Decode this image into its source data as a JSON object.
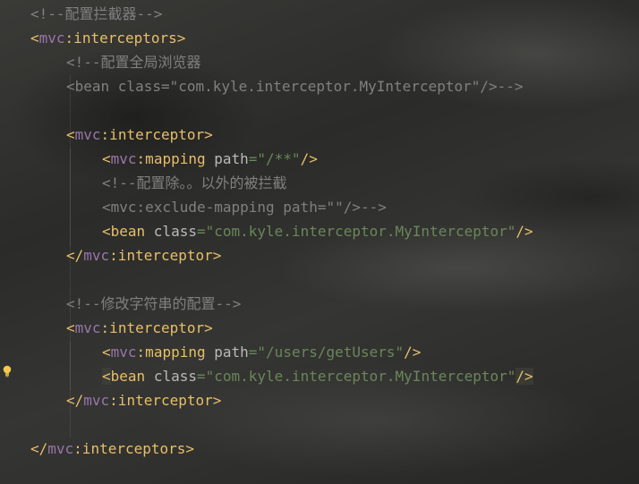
{
  "code": {
    "lines": [
      {
        "segments": [
          {
            "cls": "c",
            "text": "<!--配置拦截器-->"
          }
        ]
      },
      {
        "segments": [
          {
            "cls": "t",
            "text": "<"
          },
          {
            "cls": "ns",
            "text": "mvc"
          },
          {
            "cls": "t",
            "text": ":interceptors>"
          }
        ]
      },
      {
        "segments": [
          {
            "cls": "c",
            "text": "<!--配置全局浏览器"
          }
        ]
      },
      {
        "segments": [
          {
            "cls": "c",
            "text": "<bean class=\"com.kyle.interceptor.MyInterceptor\"/>-->"
          }
        ]
      },
      {
        "segments": []
      },
      {
        "segments": [
          {
            "cls": "t",
            "text": "<"
          },
          {
            "cls": "ns",
            "text": "mvc"
          },
          {
            "cls": "t",
            "text": ":interceptor>"
          }
        ]
      },
      {
        "segments": [
          {
            "cls": "t",
            "text": "<"
          },
          {
            "cls": "ns",
            "text": "mvc"
          },
          {
            "cls": "t",
            "text": ":mapping "
          },
          {
            "cls": "attr",
            "text": "path"
          },
          {
            "cls": "val",
            "text": "=\"/**\""
          },
          {
            "cls": "t",
            "text": "/>"
          }
        ]
      },
      {
        "segments": [
          {
            "cls": "c",
            "text": "<!--配置除。。以外的被拦截"
          }
        ]
      },
      {
        "segments": [
          {
            "cls": "c",
            "text": "<mvc:exclude-mapping path=\"\"/>-->"
          }
        ]
      },
      {
        "segments": [
          {
            "cls": "t",
            "text": "<bean "
          },
          {
            "cls": "attr",
            "text": "class"
          },
          {
            "cls": "val",
            "text": "=\"com.kyle.interceptor.MyInterceptor\""
          },
          {
            "cls": "t",
            "text": "/>"
          }
        ]
      },
      {
        "segments": [
          {
            "cls": "t",
            "text": "</"
          },
          {
            "cls": "ns",
            "text": "mvc"
          },
          {
            "cls": "t",
            "text": ":interceptor>"
          }
        ]
      },
      {
        "segments": []
      },
      {
        "segments": [
          {
            "cls": "c",
            "text": "<!--修改字符串的配置-->"
          }
        ]
      },
      {
        "segments": [
          {
            "cls": "t",
            "text": "<"
          },
          {
            "cls": "ns",
            "text": "mvc"
          },
          {
            "cls": "t",
            "text": ":interceptor>"
          }
        ]
      },
      {
        "segments": [
          {
            "cls": "t",
            "text": "<"
          },
          {
            "cls": "ns",
            "text": "mvc"
          },
          {
            "cls": "t",
            "text": ":mapping "
          },
          {
            "cls": "attr",
            "text": "path"
          },
          {
            "cls": "val",
            "text": "=\"/users/getUsers\""
          },
          {
            "cls": "t",
            "text": "/>"
          }
        ]
      },
      {
        "segments": [
          {
            "cls": "t hl",
            "text": "<"
          },
          {
            "cls": "t",
            "text": "bean "
          },
          {
            "cls": "attr",
            "text": "class"
          },
          {
            "cls": "val",
            "text": "=\"com.kyle.interceptor.MyInterceptor\""
          },
          {
            "cls": "t hl",
            "text": "/>"
          }
        ]
      },
      {
        "segments": [
          {
            "cls": "t",
            "text": "</"
          },
          {
            "cls": "ns",
            "text": "mvc"
          },
          {
            "cls": "t",
            "text": ":interceptor>"
          }
        ]
      },
      {
        "segments": []
      },
      {
        "segments": [
          {
            "cls": "t",
            "text": "</"
          },
          {
            "cls": "ns",
            "text": "mvc"
          },
          {
            "cls": "t",
            "text": ":interceptors>"
          }
        ]
      }
    ]
  },
  "gutter": {
    "intention_icon": "lightbulb-icon"
  },
  "colors": {
    "tag": "#e8bf6a",
    "namespace": "#9876aa",
    "attribute": "#bababa",
    "string_value": "#6a8759",
    "comment": "#808080"
  }
}
